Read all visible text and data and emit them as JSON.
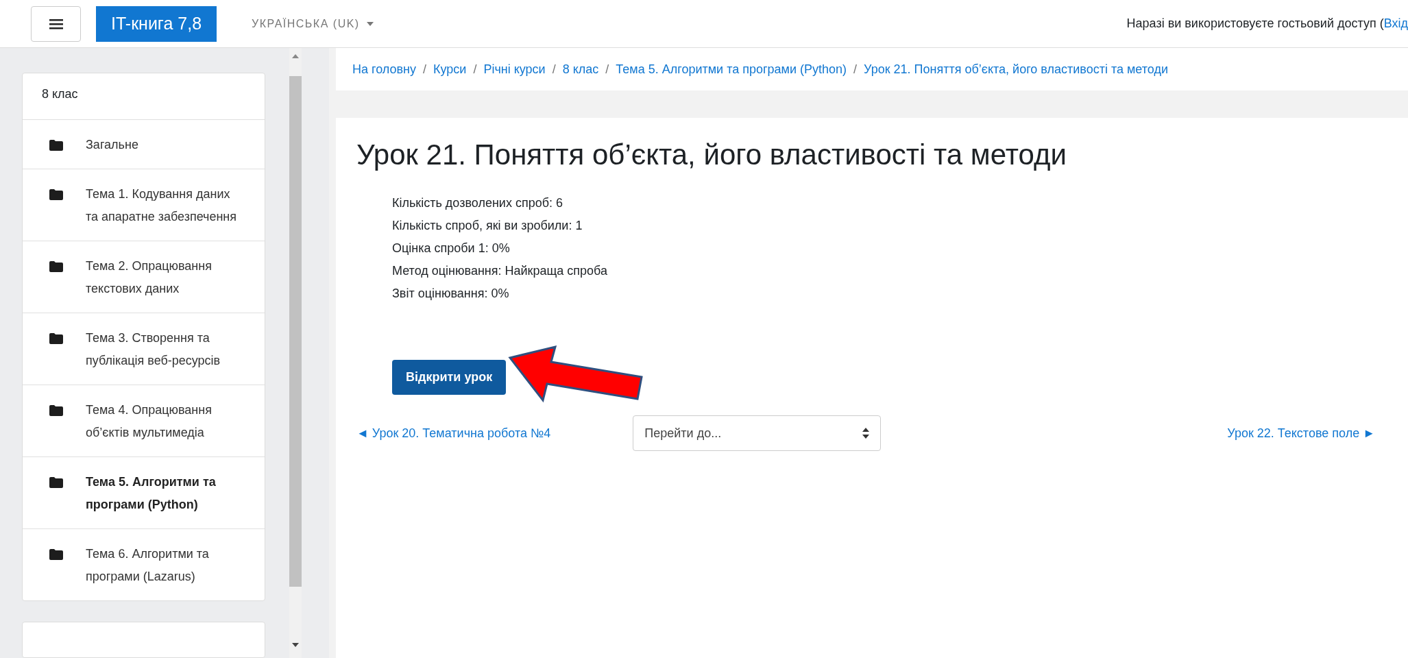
{
  "header": {
    "brand": "IT-книга 7,8",
    "language": "УКРАЇНСЬКА (UK)",
    "guest_notice": "Наразі ви використовуєте гостьовий доступ (",
    "login_link": "Вхід"
  },
  "sidebar": {
    "title": "8 клас",
    "items": [
      {
        "label": "Загальне",
        "selected": false
      },
      {
        "label": "Тема 1. Кодування даних та апаратне забезпечення",
        "selected": false
      },
      {
        "label": "Тема 2. Опрацювання текстових даних",
        "selected": false
      },
      {
        "label": "Тема 3. Створення та публікація веб-ресурсів",
        "selected": false
      },
      {
        "label": "Тема 4. Опрацювання об’єктів мультимедіа",
        "selected": false
      },
      {
        "label": "Тема 5. Алгоритми та програми (Python)",
        "selected": true
      },
      {
        "label": "Тема 6. Алгоритми та програми (Lazarus)",
        "selected": false
      }
    ]
  },
  "breadcrumb_separator": "/",
  "breadcrumbs": [
    "На головну",
    "Курси",
    "Річні курси",
    "8 клас",
    "Тема 5. Алгоритми та програми (Python)",
    "Урок 21. Поняття об’єкта, його властивості та методи"
  ],
  "lesson": {
    "title": "Урок 21. Поняття об’єкта, його властивості та методи",
    "info": [
      "Кількість дозволених спроб: 6",
      "Кількість спроб, які ви зробили: 1",
      "Оцінка спроби 1: 0%",
      "Метод оцінювання: Найкраща спроба",
      "Звіт оцінювання: 0%"
    ],
    "open_button": "Відкрити урок",
    "prev_link": "◄ Урок 20. Тематична робота №4",
    "jump_select": {
      "placeholder": "Перейти до..."
    },
    "next_link": "Урок 22. Текстове поле ►"
  }
}
